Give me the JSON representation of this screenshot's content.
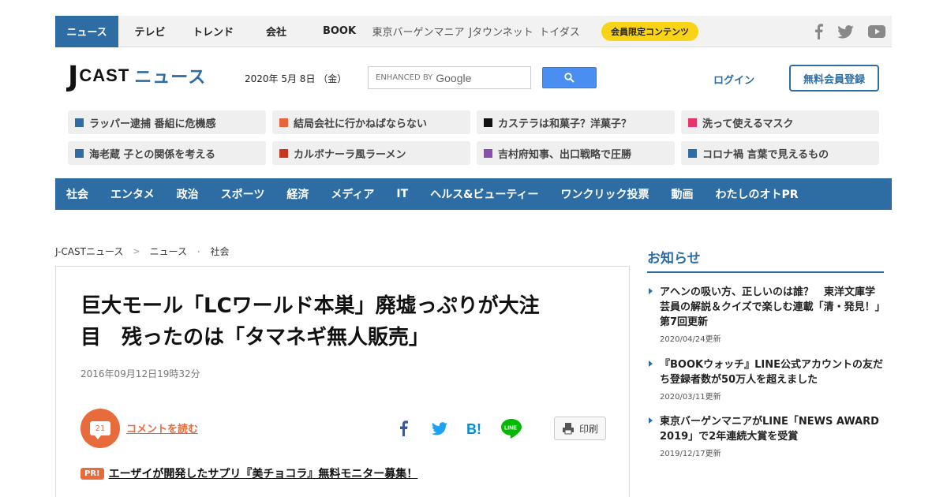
{
  "top_nav": {
    "items": [
      "ニュース",
      "テレビ",
      "トレンド",
      "会社",
      "BOOK",
      "東京バーゲンマニア",
      "Jタウンネット",
      "トイダス"
    ],
    "member_label": "会員限定コンテンツ"
  },
  "header": {
    "logo_j": "J",
    "logo_cast": "CAST",
    "logo_news": "ニュース",
    "date": "2020年 5月 8日 （金）",
    "search_enhanced": "ENHANCED BY",
    "search_google": "Google",
    "login": "ログイン",
    "register": "無料会員登録"
  },
  "trending": [
    {
      "label": "ラッパー逮捕 番組に危機感",
      "color": "#2d6da3"
    },
    {
      "label": "結局会社に行かねばならない",
      "color": "#e8643a"
    },
    {
      "label": "カステラは和菓子？洋菓子？",
      "color": "#111111"
    },
    {
      "label": "洗って使えるマスク",
      "color": "#e8336b"
    },
    {
      "label": "海老蔵 子との関係を考える",
      "color": "#2d6da3"
    },
    {
      "label": "カルボナーラ風ラーメン",
      "color": "#c8361e"
    },
    {
      "label": "吉村府知事、出口戦略で圧勝",
      "color": "#8a4fae"
    },
    {
      "label": "コロナ禍 言葉で見えるもの",
      "color": "#2d6da3"
    }
  ],
  "categories": [
    "社会",
    "エンタメ",
    "政治",
    "スポーツ",
    "経済",
    "メディア",
    "IT",
    "ヘルス&ビューティー",
    "ワンクリック投票",
    "動画",
    "わたしのオトPR"
  ],
  "breadcrumb": [
    "J-CASTニュース",
    "ニュース",
    "社会"
  ],
  "article": {
    "title_line1": "巨大モール「LCワールド本巣」廃墟っぷりが大注",
    "title_line2": "目　残ったのは「タマネギ無人販売」",
    "published": "2016年09月12日19時32分",
    "comment_count": "21",
    "comment_link": "コメントを読む",
    "print_label": "印刷",
    "pr_badge": "PR!",
    "pr_text": "エーザイが開発したサプリ『美チョコラ』無料モニター募集！"
  },
  "sidebar": {
    "title": "お知らせ",
    "items": [
      {
        "text": "アヘンの吸い方、正しいのは誰？　東洋文庫学芸員の解説＆クイズで楽しむ連載「清・発見！」第7回更新",
        "date": "2020/04/24更新"
      },
      {
        "text": "『BOOKウォッチ』LINE公式アカウントの友だち登録者数が50万人を超えました",
        "date": "2020/03/11更新"
      },
      {
        "text": "東京バーゲンマニアがLINE「NEWS AWARD 2019」で2年連続大賞を受賞",
        "date": "2019/12/17更新"
      }
    ]
  },
  "colors": {
    "brand": "#2d6da3",
    "accent": "#e86b3b",
    "member": "#f9d316"
  }
}
